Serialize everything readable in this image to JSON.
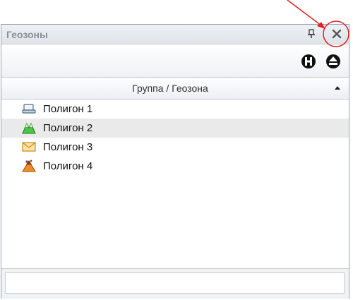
{
  "panel": {
    "title": "Геозоны"
  },
  "toolbar": {
    "buttons": [
      {
        "icon": "expand-groups-icon"
      },
      {
        "icon": "collapse-groups-icon"
      }
    ]
  },
  "table": {
    "column_header": "Группа / Геозона",
    "sort": "ascending",
    "rows": [
      {
        "label": "Полигон 1",
        "icon": "polygon-flat-icon"
      },
      {
        "label": "Полигон 2",
        "icon": "polygon-mountain-icon",
        "selected": true
      },
      {
        "label": "Полигон 3",
        "icon": "polygon-envelope-icon"
      },
      {
        "label": "Полигон 4",
        "icon": "polygon-volcano-icon"
      }
    ]
  },
  "filter": {
    "value": ""
  },
  "colors": {
    "annotation": "#e02020",
    "title_text": "#8a9099",
    "selected_row": "#eaeaea"
  }
}
